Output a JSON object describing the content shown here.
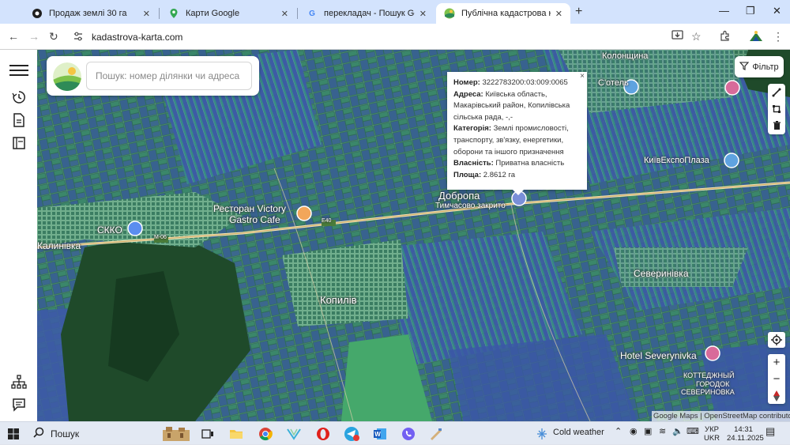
{
  "browser": {
    "tabs": [
      {
        "title": "Продаж землі 30 га",
        "icon": "site-favicon-icon",
        "active": false
      },
      {
        "title": "Карти Google",
        "icon": "google-maps-icon",
        "active": false
      },
      {
        "title": "перекладач - Пошук Google",
        "icon": "google-icon",
        "active": false
      },
      {
        "title": "Публічна кадастрова карта Ук",
        "icon": "cadastral-map-icon",
        "active": true
      }
    ],
    "url": "kadastrova-karta.com"
  },
  "search": {
    "placeholder": "Пошук: номер ділянки чи адреса"
  },
  "filter_label": "Фільтр",
  "popup": {
    "number_label": "Номер:",
    "number_value": "3222783200:03:009:0065",
    "address_label": "Адреса:",
    "address_value": "Київська область, Макарівський район, Копилівська сільська рада, -,-",
    "category_label": "Категорія:",
    "category_value": "Землі промисловості, транспорту, зв'язку, енергетики, оборони та іншого призначення",
    "ownership_label": "Власність:",
    "ownership_value": "Приватна власність",
    "area_label": "Площа:",
    "area_value": "2.8612 га",
    "close": "×"
  },
  "map_labels": {
    "restaurant": "Ресторан Victory",
    "restaurant2": "Gastro Cafe",
    "dobropak": "Добропа",
    "temp_closed": "Тимчасово закрито",
    "skko": "СККО",
    "kalynivka": "Калинівка",
    "kopyliv": "Копилів",
    "kyivexpoplaza": "КиївЕкспоПлаза",
    "severynivka": "Северинівка",
    "hotel": "Hotel Severynivka",
    "cottage1": "КОТТЕДЖНЫЙ",
    "cottage2": "ГОРОДОК",
    "cottage3": "СЕВЕРИНОВКА",
    "kolonshchyna": "Колонщина",
    "shotel": "С'отель",
    "road": "E40",
    "road2": "M-06"
  },
  "attribution": "Google Maps | OpenStreetMap contributors",
  "taskbar": {
    "search_label": "Пошук",
    "weather": "Cold weather",
    "lang1": "УКР",
    "lang2": "UKR",
    "time": "14:31",
    "date": "24.11.2025"
  },
  "colors": {
    "tabstrip": "#d3e3fd",
    "popup_bg": "#ffffff",
    "map_green": "#2f6b5a",
    "parcel_blue": "#3d5aa8"
  }
}
